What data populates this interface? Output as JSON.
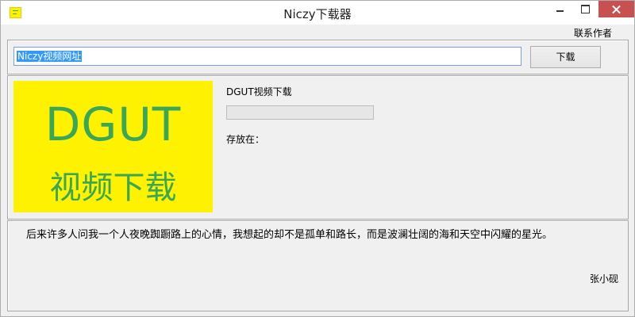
{
  "window": {
    "title": "Niczy下载器",
    "app_icon": "dgut-logo-icon",
    "controls": [
      "minimize",
      "maximize",
      "close"
    ]
  },
  "menu": {
    "contact_author": "联系作者"
  },
  "download_bar": {
    "url_value": "Niczy视频网址",
    "download_label": "下载"
  },
  "banner": {
    "line1": "DGUT",
    "line2": "视频下载",
    "background_color": "#fff200",
    "text_color": "#3aa657"
  },
  "status": {
    "file_name": "DGUT视频下载",
    "progress_percent": 0,
    "save_location_label": "存放在："
  },
  "quote": {
    "text": "后来许多人问我一个人夜晚踟蹰路上的心情，我想起的却不是孤单和路长，而是波澜壮阔的海和天空中闪耀的星光。",
    "author": "张小砚"
  },
  "colors": {
    "close_button": "#c75050",
    "input_focus_border": "#7a9fd8",
    "selection": "#3399ff"
  }
}
